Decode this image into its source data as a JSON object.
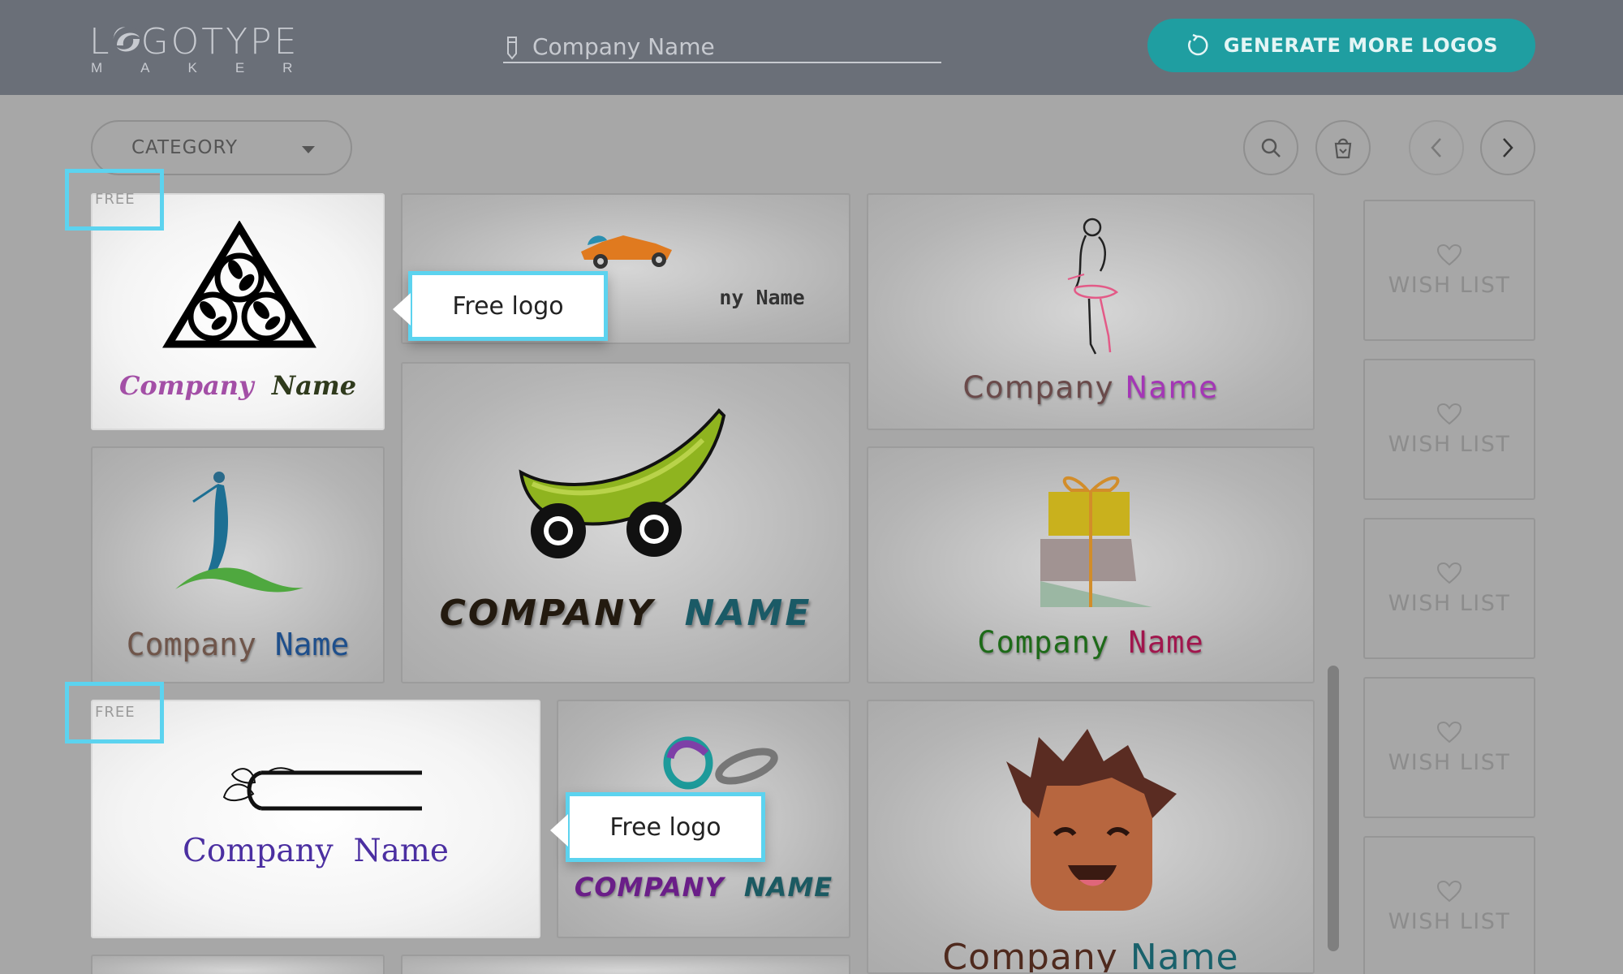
{
  "header": {
    "logo_word": "LOGOTYPE",
    "logo_sub": "MAKER",
    "company_placeholder": "Company Name",
    "generate_label": "GENERATE MORE LOGOS"
  },
  "toolbar": {
    "category_label": "CATEGORY"
  },
  "cards": [
    {
      "name_left": "Company",
      "name_right": "Name",
      "free": true
    },
    {
      "name_partial": "ny Name"
    },
    {
      "name_left": "Company",
      "name_right": "Name"
    },
    {
      "name_left": "Company",
      "name_right": "Name"
    },
    {
      "name_left": "COMPANY",
      "name_right": "NAME"
    },
    {
      "name_left": "Company",
      "name_right": "Name"
    },
    {
      "name_left": "Company",
      "name_right": "Name",
      "free": true
    },
    {
      "name_left": "COMPANY",
      "name_right": "NAME"
    },
    {
      "name_left": "Company",
      "name_right": "Name"
    }
  ],
  "free_tag": "FREE",
  "tooltip": "Free logo",
  "wishlist": [
    "WISH LIST",
    "WISH LIST",
    "WISH LIST",
    "WISH LIST",
    "WISH LIST"
  ],
  "colors": {
    "header_bg": "#6a6f78",
    "accent_teal": "#1f9ea1",
    "highlight": "#5cd3ef",
    "page_bg": "#a7a7a7"
  }
}
